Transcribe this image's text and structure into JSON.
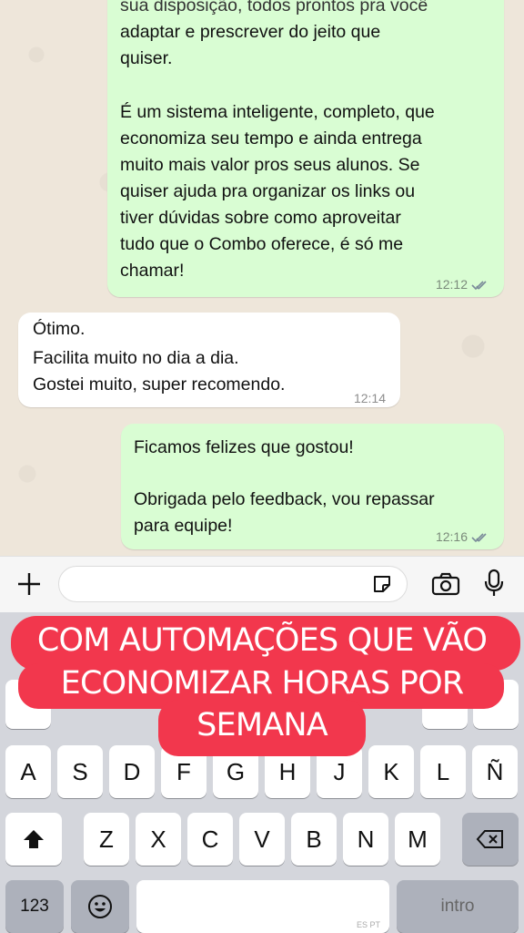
{
  "chat": {
    "messages": [
      {
        "direction": "outgoing",
        "lines": [
          "sua disposição, todos prontos pra você",
          "adaptar e prescrever do jeito que",
          "quiser.",
          "",
          "É um sistema inteligente, completo, que",
          "economiza seu tempo e ainda entrega",
          "muito mais valor pros seus alunos. Se",
          "quiser ajuda pra organizar os links ou",
          "tiver dúvidas sobre como aproveitar",
          "tudo que o Combo oferece, é só me",
          "chamar!"
        ],
        "time": "12:12",
        "read": true
      },
      {
        "direction": "incoming",
        "lines": [
          "Ótimo.",
          "Facilita muito no dia a dia.",
          "Gostei muito, super recomendo."
        ],
        "time": "12:14"
      },
      {
        "direction": "outgoing",
        "lines": [
          "Ficamos felizes que gostou!",
          "",
          "Obrigada pelo feedback, vou repassar",
          "para equipe!"
        ],
        "time": "12:16",
        "read": true
      }
    ]
  },
  "composer": {
    "icons": [
      "plus-icon",
      "sticker-icon",
      "camera-icon",
      "mic-icon"
    ]
  },
  "overlay": {
    "lines": [
      "COM AUTOMAÇÕES QUE VÃO",
      "ECONOMIZAR HORAS POR",
      "SEMANA"
    ],
    "color": "#f2374d"
  },
  "keyboard": {
    "row2": [
      "A",
      "S",
      "D",
      "F",
      "G",
      "H",
      "J",
      "K",
      "L",
      "Ñ"
    ],
    "row3": [
      "Z",
      "X",
      "C",
      "V",
      "B",
      "N",
      "M"
    ],
    "numbers_label": "123",
    "space_hint": "ES PT",
    "return_label": "intro",
    "icons": [
      "shift-icon",
      "backspace-icon",
      "emoji-icon"
    ]
  }
}
